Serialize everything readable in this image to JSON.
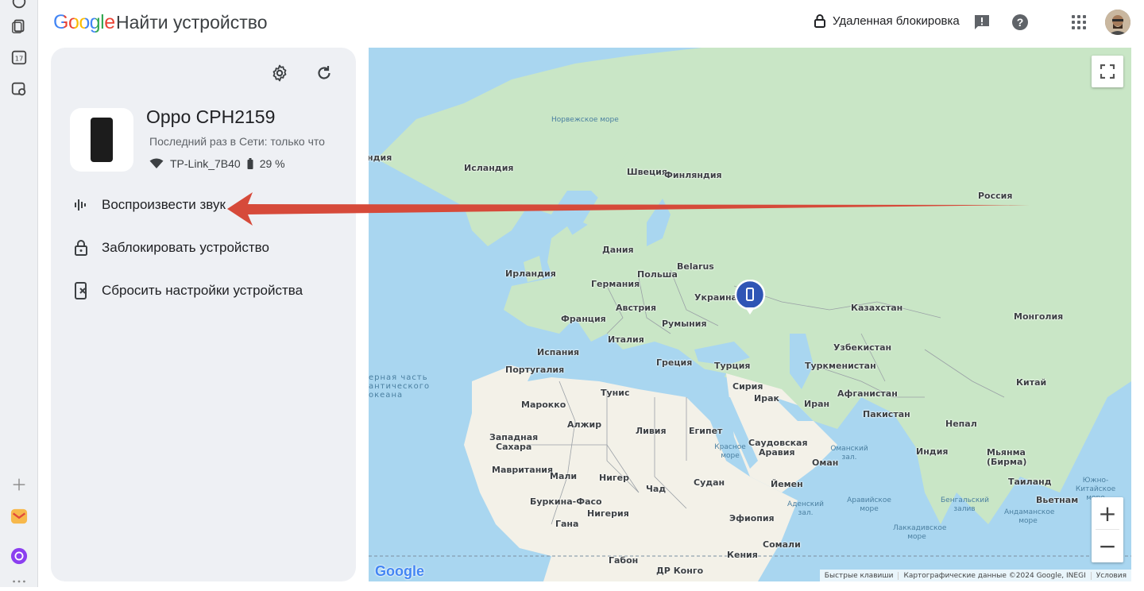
{
  "header": {
    "logo": "Google",
    "title": "Найти устройство",
    "remote_lock_label": "Удаленная блокировка"
  },
  "device": {
    "name": "Oppo CPH2159",
    "last_seen": "Последний раз в Сети: только что",
    "wifi": "TP-Link_7B40",
    "battery": "29 %"
  },
  "actions": [
    {
      "label": "Воспроизвести звук",
      "icon": "sound-wave-icon"
    },
    {
      "label": "Заблокировать устройство",
      "icon": "lock-icon"
    },
    {
      "label": "Сбросить настройки устройства",
      "icon": "phone-erase-icon"
    }
  ],
  "map": {
    "labels": {
      "iceland": "Исландия",
      "norway_sea": "Норвежское море",
      "sweden": "Швеция",
      "finland": "Финляндия",
      "russia": "Россия",
      "denmark": "Дания",
      "ireland": "Ирландия",
      "germany": "Германия",
      "poland": "Польша",
      "belarus": "Belarus",
      "ukraine": "Украина",
      "kazakhstan": "Казахстан",
      "mongolia": "Монголия",
      "france": "Франция",
      "austria": "Австрия",
      "romania": "Румыния",
      "italy": "Италия",
      "spain": "Испания",
      "portugal": "Португалия",
      "greece": "Греция",
      "turkey": "Турция",
      "uzbekistan": "Узбекистан",
      "turkmenistan": "Туркменистан",
      "china": "Китай",
      "syria": "Сирия",
      "iraq": "Ирак",
      "iran": "Иран",
      "afghanistan": "Афганистан",
      "tunisia": "Тунис",
      "morocco": "Марокко",
      "algeria": "Алжир",
      "libya": "Ливия",
      "egypt": "Египет",
      "pakistan": "Пакистан",
      "nepal": "Непал",
      "western_sahara_1": "Западная",
      "western_sahara_2": "Сахара",
      "saudi_1": "Саудовская",
      "saudi_2": "Аравия",
      "oman": "Оман",
      "india": "Индия",
      "myanmar_1": "Мьянма",
      "myanmar_2": "(Бирма)",
      "mauritania": "Мавритания",
      "mali": "Мали",
      "niger": "Нигер",
      "chad": "Чад",
      "sudan": "Судан",
      "yemen": "Йемен",
      "thailand": "Таиланд",
      "burkina": "Буркина-Фасо",
      "nigeria": "Нигерия",
      "ethiopia": "Эфиопия",
      "vietnam": "Вьетнам",
      "ghana": "Гана",
      "gabon": "Габон",
      "drc": "ДР Конго",
      "kenya": "Кения",
      "somalia": "Сомали",
      "atlantic_1": "ерная часть",
      "atlantic_2": "антического",
      "atlantic_3": "океана",
      "edge_west": "ндия",
      "arabian_sea": "Аравийское море",
      "bay_bengal": "Бенгальский залив",
      "red_sea": "Красное море",
      "aden_gulf": "Аденский зал.",
      "laccadive_sea": "Лаккадивское море",
      "andaman_sea": "Андаманское море",
      "south_china_sea": "Южно-Китайское море",
      "oman_gulf": "Оманский зал."
    },
    "footer": {
      "shortcuts": "Быстрые клавиши",
      "map_data": "Картографические данные ©2024 Google, INEGI",
      "terms": "Условия"
    },
    "watermark": "Google"
  },
  "colors": {
    "water": "#a9d6f0",
    "land": "#c9e6c6",
    "desert": "#f3f1e8",
    "marker": "#2f55b5",
    "arrow": "#d64a3a"
  }
}
